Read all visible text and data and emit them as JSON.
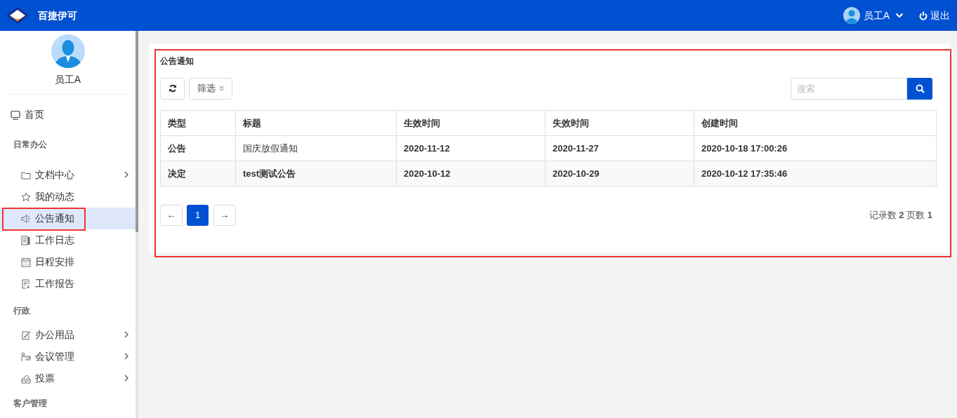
{
  "header": {
    "app_name": "百捷伊可",
    "user": "员工A",
    "logout": "退出"
  },
  "sidebar": {
    "user_name": "员工A",
    "items": [
      {
        "kind": "link",
        "label": "首页",
        "selected": false
      },
      {
        "kind": "section",
        "label": "日常办公"
      },
      {
        "kind": "item",
        "label": "文档中心",
        "selected": false,
        "has_children": true
      },
      {
        "kind": "item",
        "label": "我的动态",
        "selected": false,
        "has_children": false
      },
      {
        "kind": "item",
        "label": "公告通知",
        "selected": true,
        "has_children": false
      },
      {
        "kind": "item",
        "label": "工作日志",
        "selected": false,
        "has_children": false
      },
      {
        "kind": "item",
        "label": "日程安排",
        "selected": false,
        "has_children": false
      },
      {
        "kind": "item",
        "label": "工作报告",
        "selected": false,
        "has_children": false
      },
      {
        "kind": "section",
        "label": "行政"
      },
      {
        "kind": "item",
        "label": "办公用品",
        "selected": false,
        "has_children": true
      },
      {
        "kind": "item",
        "label": "会议管理",
        "selected": false,
        "has_children": true
      },
      {
        "kind": "item",
        "label": "投票",
        "selected": false,
        "has_children": true
      },
      {
        "kind": "section",
        "label": "客户管理"
      }
    ]
  },
  "panel": {
    "title": "公告通知",
    "filter_button": "筛选",
    "search": {
      "placeholder": "搜索"
    },
    "table": {
      "columns": [
        "类型",
        "标题",
        "生效时间",
        "失效时间",
        "创建时间"
      ],
      "rows": [
        [
          {
            "text": "公告",
            "bold": true
          },
          {
            "text": "国庆放假通知",
            "bold": false
          },
          {
            "text": "2020-11-12",
            "bold": true
          },
          {
            "text": "2020-11-27",
            "bold": true
          },
          {
            "text": "2020-10-18 17:00:26",
            "bold": true
          }
        ],
        [
          {
            "text": "决定",
            "bold": true
          },
          {
            "text": "test测试公告",
            "bold": true
          },
          {
            "text": "2020-10-12",
            "bold": true
          },
          {
            "text": "2020-10-29",
            "bold": true
          },
          {
            "text": "2020-10-12 17:35:46",
            "bold": true
          }
        ]
      ]
    },
    "pagination": {
      "prev": "←",
      "pages": [
        {
          "label": "1",
          "selected": true
        }
      ],
      "next": "→"
    },
    "summary": "记录数 **2** 页数 **1**"
  }
}
